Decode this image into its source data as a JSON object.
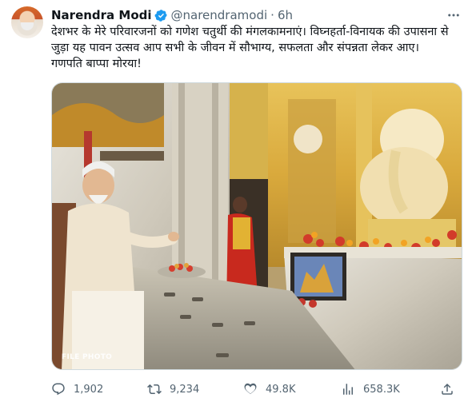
{
  "tweet": {
    "author_name": "Narendra Modi",
    "handle": "@narendramodi",
    "separator": "·",
    "time": "6h",
    "text": "देशभर के मेरे परिवारजनों को गणेश चतुर्थी की मंगलकामनाएं। विघ्नहर्ता-विनायक की उपासना से जुड़ा यह पावन उत्सव आप सभी के जीवन में सौभाग्य, सफलता और संपन्नता लेकर आए। गणपति बाप्पा मोरया!",
    "media": {
      "overlay_text": "FILE PHOTO"
    }
  },
  "actions": {
    "replies": "1,902",
    "retweets": "9,234",
    "likes": "49.8K",
    "views": "658.3K"
  },
  "icons": {
    "verified": "verified-badge-icon",
    "more": "more-horizontal-icon",
    "reply": "reply-icon",
    "retweet": "retweet-icon",
    "like": "heart-icon",
    "views": "views-chart-icon",
    "share": "share-icon"
  },
  "colors": {
    "text": "#0f1419",
    "secondary": "#536471",
    "verified": "#1d9bf0",
    "border": "#cfd9de"
  }
}
